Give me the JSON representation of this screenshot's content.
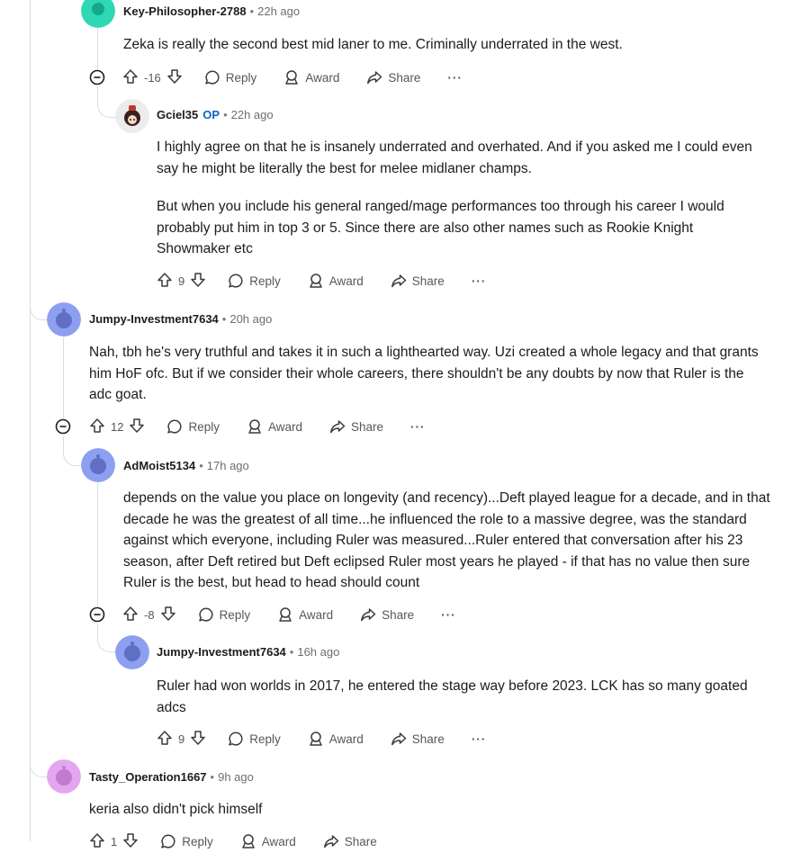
{
  "comments": [
    {
      "user": "Key-Philosopher-2788",
      "time": "22h ago",
      "paragraphs": [
        "Zeka is really the second best mid laner to me. Criminally underrated in the west."
      ],
      "score": "-16",
      "avatar_color": "#2ed8b4"
    },
    {
      "user": "Gciel35",
      "op": "OP",
      "time": "22h ago",
      "paragraphs": [
        "I highly agree on that he is insanely underrated and overhated. And if you asked me I could even say he might be literally the best for melee midlaner champs.",
        "But when you include his general ranged/mage performances too through his career I would probably put him in top 3 or 5. Since there are also other names such as Rookie Knight Showmaker etc"
      ],
      "score": "9",
      "avatar_color": "#e8e8e8"
    },
    {
      "user": "Jumpy-Investment7634",
      "time": "20h ago",
      "paragraphs": [
        "Nah, tbh he's very truthful and takes it in such a lighthearted way. Uzi created a whole legacy and that grants him HoF ofc. But if we consider their whole careers, there shouldn't be any doubts by now that Ruler is the adc goat."
      ],
      "score": "12",
      "avatar_color": "#8d9ff0"
    },
    {
      "user": "AdMoist5134",
      "time": "17h ago",
      "paragraphs": [
        "depends on the value you place on longevity (and recency)...Deft played league for a decade, and in that decade he was the greatest of all time...he influenced the role to a massive degree, was the standard against which everyone, including Ruler was measured...Ruler entered that conversation after his 23 season, after Deft retired but Deft eclipsed Ruler most years he played - if that has no value then sure Ruler is the best, but head to head should count"
      ],
      "score": "-8",
      "avatar_color": "#8d9ff0"
    },
    {
      "user": "Jumpy-Investment7634",
      "time": "16h ago",
      "paragraphs": [
        "Ruler had won worlds in 2017, he entered the stage way before 2023. LCK has so many goated adcs"
      ],
      "score": "9",
      "avatar_color": "#8d9ff0"
    },
    {
      "user": "Tasty_Operation1667",
      "time": "9h ago",
      "paragraphs": [
        "keria also didn't pick himself"
      ],
      "score": "1",
      "avatar_color": "#e3a6f0"
    }
  ],
  "actions": {
    "reply": "Reply",
    "award": "Award",
    "share": "Share",
    "more": "···"
  },
  "separator": "•"
}
